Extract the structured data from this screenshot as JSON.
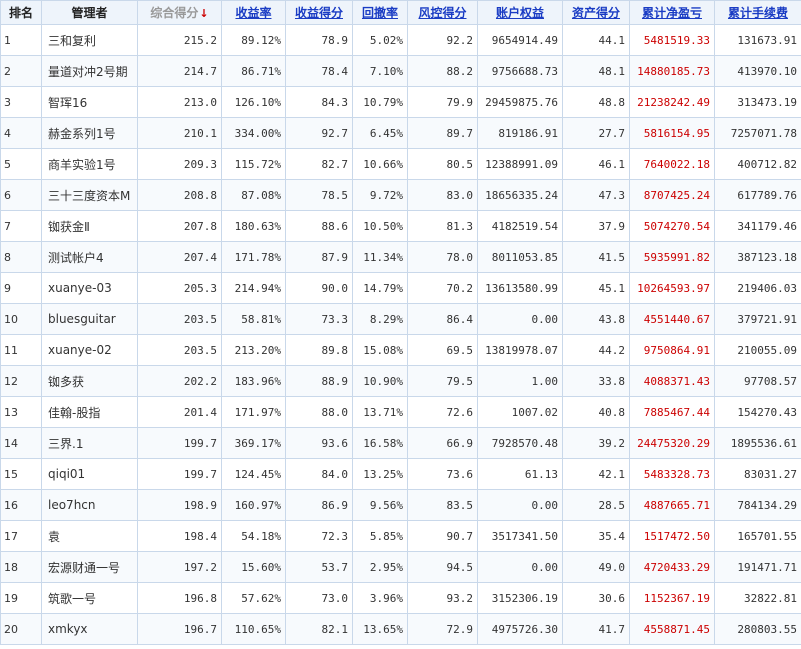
{
  "columns": [
    "排名",
    "管理者",
    "综合得分",
    "收益率",
    "收益得分",
    "回撤率",
    "风控得分",
    "账户权益",
    "资产得分",
    "累计净盈亏",
    "累计手续费"
  ],
  "sort_arrow": "↓",
  "colors": {
    "header_bg": "#eef4fb",
    "border": "#c9d8ea",
    "link": "#1a3cc4",
    "profit_red": "#cc0000"
  },
  "rows": [
    {
      "rank": "1",
      "manager": "三和复利",
      "score": "215.2",
      "return_rate": "89.12%",
      "return_score": "78.9",
      "drawdown": "5.02%",
      "risk_score": "92.2",
      "equity": "9654914.49",
      "asset_score": "44.1",
      "net_pnl": "5481519.33",
      "fees": "131673.91"
    },
    {
      "rank": "2",
      "manager": "量道对冲2号期",
      "score": "214.7",
      "return_rate": "86.71%",
      "return_score": "78.4",
      "drawdown": "7.10%",
      "risk_score": "88.2",
      "equity": "9756688.73",
      "asset_score": "48.1",
      "net_pnl": "14880185.73",
      "fees": "413970.10"
    },
    {
      "rank": "3",
      "manager": "智珲16",
      "score": "213.0",
      "return_rate": "126.10%",
      "return_score": "84.3",
      "drawdown": "10.79%",
      "risk_score": "79.9",
      "equity": "29459875.76",
      "asset_score": "48.8",
      "net_pnl": "21238242.49",
      "fees": "313473.19"
    },
    {
      "rank": "4",
      "manager": "赫金系列1号",
      "score": "210.1",
      "return_rate": "334.00%",
      "return_score": "92.7",
      "drawdown": "6.45%",
      "risk_score": "89.7",
      "equity": "819186.91",
      "asset_score": "27.7",
      "net_pnl": "5816154.95",
      "fees": "7257071.78"
    },
    {
      "rank": "5",
      "manager": "商羊实验1号",
      "score": "209.3",
      "return_rate": "115.72%",
      "return_score": "82.7",
      "drawdown": "10.66%",
      "risk_score": "80.5",
      "equity": "12388991.09",
      "asset_score": "46.1",
      "net_pnl": "7640022.18",
      "fees": "400712.82"
    },
    {
      "rank": "6",
      "manager": "三十三度资本M",
      "score": "208.8",
      "return_rate": "87.08%",
      "return_score": "78.5",
      "drawdown": "9.72%",
      "risk_score": "83.0",
      "equity": "18656335.24",
      "asset_score": "47.3",
      "net_pnl": "8707425.24",
      "fees": "617789.76"
    },
    {
      "rank": "7",
      "manager": "铷获金Ⅱ",
      "score": "207.8",
      "return_rate": "180.63%",
      "return_score": "88.6",
      "drawdown": "10.50%",
      "risk_score": "81.3",
      "equity": "4182519.54",
      "asset_score": "37.9",
      "net_pnl": "5074270.54",
      "fees": "341179.46"
    },
    {
      "rank": "8",
      "manager": "测试帐户4",
      "score": "207.4",
      "return_rate": "171.78%",
      "return_score": "87.9",
      "drawdown": "11.34%",
      "risk_score": "78.0",
      "equity": "8011053.85",
      "asset_score": "41.5",
      "net_pnl": "5935991.82",
      "fees": "387123.18"
    },
    {
      "rank": "9",
      "manager": "xuanye-03",
      "score": "205.3",
      "return_rate": "214.94%",
      "return_score": "90.0",
      "drawdown": "14.79%",
      "risk_score": "70.2",
      "equity": "13613580.99",
      "asset_score": "45.1",
      "net_pnl": "10264593.97",
      "fees": "219406.03"
    },
    {
      "rank": "10",
      "manager": "bluesguitar",
      "score": "203.5",
      "return_rate": "58.81%",
      "return_score": "73.3",
      "drawdown": "8.29%",
      "risk_score": "86.4",
      "equity": "0.00",
      "asset_score": "43.8",
      "net_pnl": "4551440.67",
      "fees": "379721.91"
    },
    {
      "rank": "11",
      "manager": "xuanye-02",
      "score": "203.5",
      "return_rate": "213.20%",
      "return_score": "89.8",
      "drawdown": "15.08%",
      "risk_score": "69.5",
      "equity": "13819978.07",
      "asset_score": "44.2",
      "net_pnl": "9750864.91",
      "fees": "210055.09"
    },
    {
      "rank": "12",
      "manager": "铷多获",
      "score": "202.2",
      "return_rate": "183.96%",
      "return_score": "88.9",
      "drawdown": "10.90%",
      "risk_score": "79.5",
      "equity": "1.00",
      "asset_score": "33.8",
      "net_pnl": "4088371.43",
      "fees": "97708.57"
    },
    {
      "rank": "13",
      "manager": "佳翰-股指",
      "score": "201.4",
      "return_rate": "171.97%",
      "return_score": "88.0",
      "drawdown": "13.71%",
      "risk_score": "72.6",
      "equity": "1007.02",
      "asset_score": "40.8",
      "net_pnl": "7885467.44",
      "fees": "154270.43"
    },
    {
      "rank": "14",
      "manager": "三界.1",
      "score": "199.7",
      "return_rate": "369.17%",
      "return_score": "93.6",
      "drawdown": "16.58%",
      "risk_score": "66.9",
      "equity": "7928570.48",
      "asset_score": "39.2",
      "net_pnl": "24475320.29",
      "fees": "1895536.61"
    },
    {
      "rank": "15",
      "manager": "qiqi01",
      "score": "199.7",
      "return_rate": "124.45%",
      "return_score": "84.0",
      "drawdown": "13.25%",
      "risk_score": "73.6",
      "equity": "61.13",
      "asset_score": "42.1",
      "net_pnl": "5483328.73",
      "fees": "83031.27"
    },
    {
      "rank": "16",
      "manager": "leo7hcn",
      "score": "198.9",
      "return_rate": "160.97%",
      "return_score": "86.9",
      "drawdown": "9.56%",
      "risk_score": "83.5",
      "equity": "0.00",
      "asset_score": "28.5",
      "net_pnl": "4887665.71",
      "fees": "784134.29"
    },
    {
      "rank": "17",
      "manager": "袁",
      "score": "198.4",
      "return_rate": "54.18%",
      "return_score": "72.3",
      "drawdown": "5.85%",
      "risk_score": "90.7",
      "equity": "3517341.50",
      "asset_score": "35.4",
      "net_pnl": "1517472.50",
      "fees": "165701.55"
    },
    {
      "rank": "18",
      "manager": "宏源财通一号",
      "score": "197.2",
      "return_rate": "15.60%",
      "return_score": "53.7",
      "drawdown": "2.95%",
      "risk_score": "94.5",
      "equity": "0.00",
      "asset_score": "49.0",
      "net_pnl": "4720433.29",
      "fees": "191471.71"
    },
    {
      "rank": "19",
      "manager": "筑歌一号",
      "score": "196.8",
      "return_rate": "57.62%",
      "return_score": "73.0",
      "drawdown": "3.96%",
      "risk_score": "93.2",
      "equity": "3152306.19",
      "asset_score": "30.6",
      "net_pnl": "1152367.19",
      "fees": "32822.81"
    },
    {
      "rank": "20",
      "manager": "xmkyx",
      "score": "196.7",
      "return_rate": "110.65%",
      "return_score": "82.1",
      "drawdown": "13.65%",
      "risk_score": "72.9",
      "equity": "4975726.30",
      "asset_score": "41.7",
      "net_pnl": "4558871.45",
      "fees": "280803.55"
    }
  ]
}
